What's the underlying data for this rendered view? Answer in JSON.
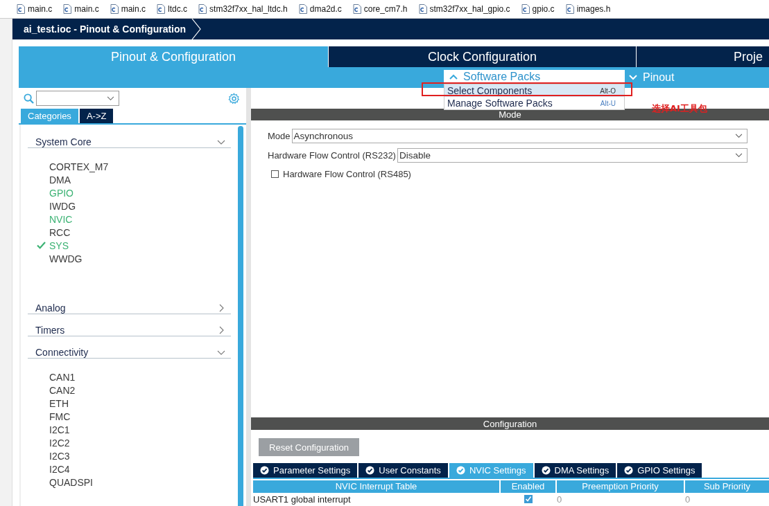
{
  "file_tabs": [
    {
      "name": "main.c"
    },
    {
      "name": "main.c"
    },
    {
      "name": "main.c"
    },
    {
      "name": "ltdc.c"
    },
    {
      "name": "stm32f7xx_hal_ltdc.h"
    },
    {
      "name": "dma2d.c"
    },
    {
      "name": "core_cm7.h"
    },
    {
      "name": "stm32f7xx_hal_gpio.c"
    },
    {
      "name": "gpio.c"
    },
    {
      "name": "images.h"
    }
  ],
  "title": "ai_test.ioc - Pinout & Configuration",
  "main_tabs": [
    {
      "label": "Pinout & Configuration",
      "selected": true
    },
    {
      "label": "Clock Configuration",
      "selected": false
    },
    {
      "label": "Proje",
      "selected": false
    }
  ],
  "toolbar": {
    "software_packs": "Software Packs",
    "pinout": "Pinout"
  },
  "software_packs_menu": [
    {
      "label": "Select Components",
      "shortcut": "Alt-O",
      "selected": true
    },
    {
      "label": "Manage Software Packs",
      "shortcut": "Alt-U",
      "selected": false
    }
  ],
  "annotation": {
    "text": "选择AI工具包"
  },
  "sidebar": {
    "tabs": [
      {
        "label": "Categories",
        "selected": true
      },
      {
        "label": "A->Z",
        "selected": false
      }
    ],
    "categories": [
      {
        "label": "System Core",
        "expanded": true,
        "items": [
          {
            "label": "CORTEX_M7",
            "kind": "default"
          },
          {
            "label": "DMA",
            "kind": "default"
          },
          {
            "label": "GPIO",
            "kind": "partial"
          },
          {
            "label": "IWDG",
            "kind": "default"
          },
          {
            "label": "NVIC",
            "kind": "partial"
          },
          {
            "label": "RCC",
            "kind": "default"
          },
          {
            "label": "SYS",
            "kind": "configured"
          },
          {
            "label": "WWDG",
            "kind": "default"
          }
        ]
      },
      {
        "label": "Analog",
        "expanded": false
      },
      {
        "label": "Timers",
        "expanded": false
      },
      {
        "label": "Connectivity",
        "expanded": true,
        "items": [
          {
            "label": "CAN1",
            "kind": "default"
          },
          {
            "label": "CAN2",
            "kind": "default"
          },
          {
            "label": "ETH",
            "kind": "default"
          },
          {
            "label": "FMC",
            "kind": "default"
          },
          {
            "label": "I2C1",
            "kind": "default"
          },
          {
            "label": "I2C2",
            "kind": "default"
          },
          {
            "label": "I2C3",
            "kind": "default"
          },
          {
            "label": "I2C4",
            "kind": "default"
          },
          {
            "label": "QUADSPI",
            "kind": "default"
          }
        ]
      }
    ]
  },
  "mode_section": {
    "title": "Mode",
    "fields": [
      {
        "label": "Mode",
        "value": "Asynchronous"
      },
      {
        "label": "Hardware Flow Control (RS232)",
        "value": "Disable"
      }
    ],
    "checkbox": {
      "label": "Hardware Flow Control (RS485)",
      "checked": false
    }
  },
  "configuration": {
    "title": "Configuration",
    "reset_button": "Reset Configuration",
    "tabs": [
      {
        "label": "Parameter Settings",
        "selected": false
      },
      {
        "label": "User Constants",
        "selected": false
      },
      {
        "label": "NVIC Settings",
        "selected": true
      },
      {
        "label": "DMA Settings",
        "selected": false
      },
      {
        "label": "GPIO Settings",
        "selected": false
      }
    ],
    "columns": [
      "NVIC Interrupt Table",
      "Enabled",
      "Preemption Priority",
      "Sub Priority"
    ],
    "rows": [
      {
        "name": "USART1 global interrupt",
        "enabled": true,
        "preemption": "0",
        "sub": "0"
      }
    ]
  }
}
